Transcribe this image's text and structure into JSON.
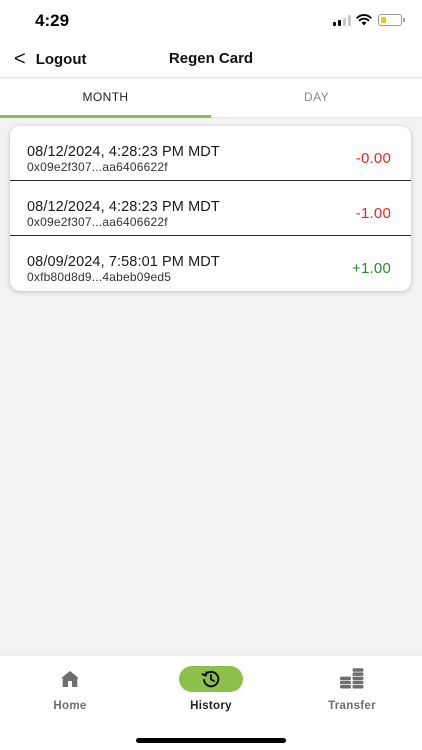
{
  "status_bar": {
    "time": "4:29"
  },
  "header": {
    "back_label": "Logout",
    "title": "Regen Card"
  },
  "tabs": [
    {
      "label": "MONTH",
      "active": true
    },
    {
      "label": "DAY",
      "active": false
    }
  ],
  "transactions": [
    {
      "date": "08/12/2024, 4:28:23 PM MDT",
      "hash": "0x09e2f307...aa6406622f",
      "amount": "-0.00",
      "type": "negative"
    },
    {
      "date": "08/12/2024, 4:28:23 PM MDT",
      "hash": "0x09e2f307...aa6406622f",
      "amount": "-1.00",
      "type": "negative"
    },
    {
      "date": "08/09/2024, 7:58:01 PM MDT",
      "hash": "0xfb80d8d9...4abeb09ed5",
      "amount": "+1.00",
      "type": "positive"
    }
  ],
  "bottom_nav": [
    {
      "label": "Home",
      "icon": "home-icon",
      "active": false
    },
    {
      "label": "History",
      "icon": "history-icon",
      "active": true
    },
    {
      "label": "Transfer",
      "icon": "coins-icon",
      "active": false
    }
  ],
  "colors": {
    "accent": "#8dc04a",
    "negative": "#e0292b",
    "positive": "#2b8a2b"
  }
}
